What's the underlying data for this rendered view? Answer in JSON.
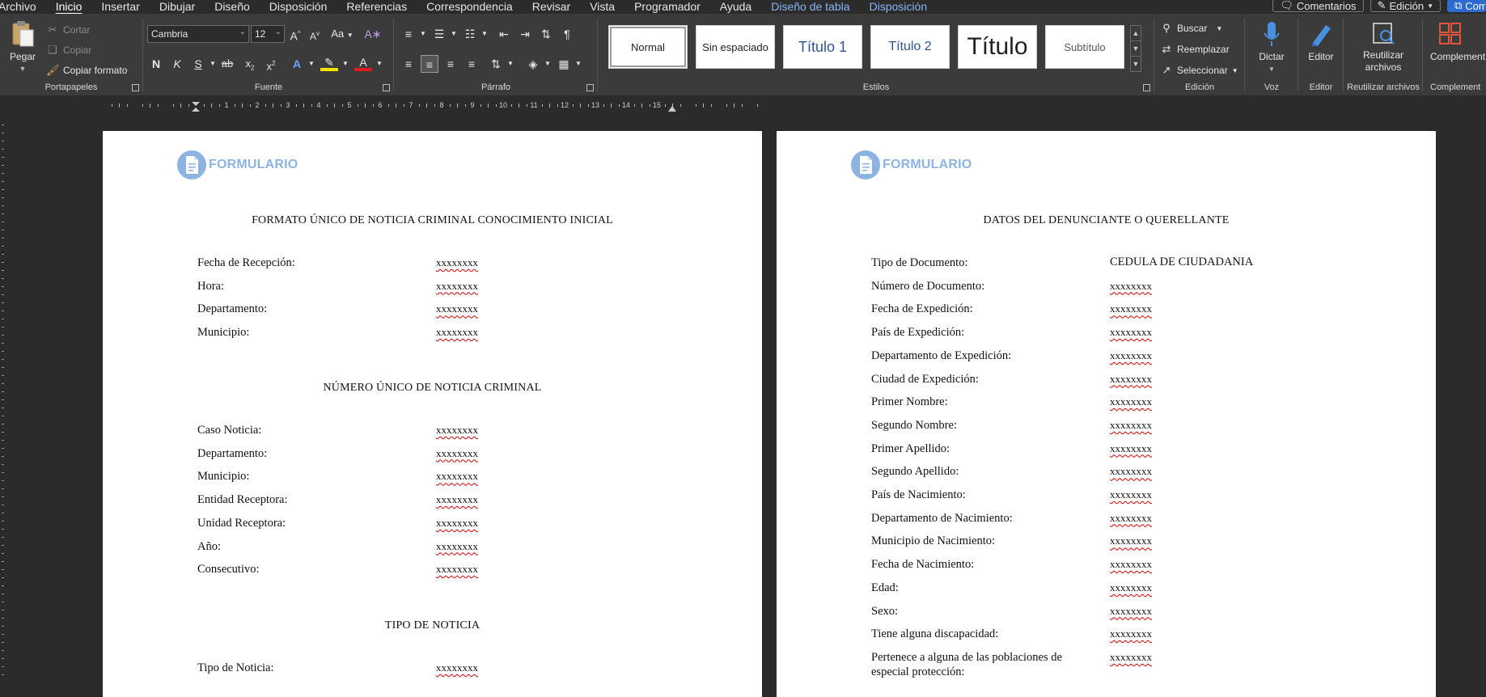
{
  "menu": {
    "tabs": [
      "Archivo",
      "Inicio",
      "Insertar",
      "Dibujar",
      "Diseño",
      "Disposición",
      "Referencias",
      "Correspondencia",
      "Revisar",
      "Vista",
      "Programador",
      "Ayuda"
    ],
    "active_tab": "Inicio",
    "contextual_tabs": [
      "Diseño de tabla",
      "Disposición"
    ],
    "comments_label": "Comentarios",
    "editing_label": "Edición",
    "share_label": "Com"
  },
  "ribbon": {
    "clipboard": {
      "label": "Portapapeles",
      "paste": "Pegar",
      "cut": "Cortar",
      "copy": "Copiar",
      "format_painter": "Copiar formato"
    },
    "font": {
      "label": "Fuente",
      "family": "Cambria",
      "size": "12",
      "change_case": "Aa"
    },
    "paragraph": {
      "label": "Párrafo"
    },
    "styles": {
      "label": "Estilos",
      "items": [
        "Normal",
        "Sin espaciado",
        "Título 1",
        "Título 2",
        "Título",
        "Subtítulo"
      ],
      "selected": "Normal"
    },
    "editing": {
      "label": "Edición",
      "find": "Buscar",
      "replace": "Reemplazar",
      "select": "Seleccionar"
    },
    "voice": {
      "label": "Voz",
      "dictate": "Dictar"
    },
    "editor": {
      "label": "Editor",
      "button": "Editor"
    },
    "reuse": {
      "label": "Reutilizar archivos",
      "button_line1": "Reutilizar",
      "button_line2": "archivos"
    },
    "addins": {
      "label": "Complement",
      "button": "Complement"
    }
  },
  "ruler": {
    "numbers": [
      "1",
      "2",
      "3",
      "4",
      "5",
      "6",
      "7",
      "8",
      "9",
      "10",
      "11",
      "12",
      "13",
      "14",
      "15"
    ]
  },
  "pages": [
    {
      "logo_text": "FORMULARIO",
      "sections": [
        {
          "title": "FORMATO ÚNICO DE NOTICIA CRIMINAL CONOCIMIENTO INICIAL",
          "fields": [
            {
              "label": "Fecha de Recepción:",
              "value": "xxxxxxxx"
            },
            {
              "label": "Hora:",
              "value": "xxxxxxxx"
            },
            {
              "label": "Departamento:",
              "value": "xxxxxxxx"
            },
            {
              "label": "Municipio:",
              "value": "xxxxxxxx"
            }
          ]
        },
        {
          "title": "NÚMERO ÚNICO DE NOTICIA CRIMINAL",
          "fields": [
            {
              "label": "Caso Noticia:",
              "value": "xxxxxxxx"
            },
            {
              "label": "Departamento:",
              "value": "xxxxxxxx"
            },
            {
              "label": "Municipio:",
              "value": "xxxxxxxx"
            },
            {
              "label": "Entidad Receptora:",
              "value": "xxxxxxxx"
            },
            {
              "label": "Unidad Receptora:",
              "value": "xxxxxxxx"
            },
            {
              "label": "Año:",
              "value": "xxxxxxxx"
            },
            {
              "label": "Consecutivo:",
              "value": "xxxxxxxx"
            }
          ]
        },
        {
          "title": "TIPO DE NOTICIA",
          "fields": [
            {
              "label": "Tipo de Noticia:",
              "value": "xxxxxxxx"
            }
          ]
        }
      ]
    },
    {
      "logo_text": "FORMULARIO",
      "sections": [
        {
          "title": "DATOS DEL DENUNCIANTE O QUERELLANTE",
          "fields": [
            {
              "label": "Tipo de Documento:",
              "value": "CEDULA DE CIUDADANIA"
            },
            {
              "label": "Número de Documento:",
              "value": "xxxxxxxx"
            },
            {
              "label": "Fecha de Expedición:",
              "value": "xxxxxxxx"
            },
            {
              "label": "País de Expedición:",
              "value": "xxxxxxxx"
            },
            {
              "label": "Departamento de Expedición:",
              "value": "xxxxxxxx"
            },
            {
              "label": "Ciudad de Expedición:",
              "value": "xxxxxxxx"
            },
            {
              "label": "Primer Nombre:",
              "value": "xxxxxxxx"
            },
            {
              "label": "Segundo Nombre:",
              "value": "xxxxxxxx"
            },
            {
              "label": "Primer Apellido:",
              "value": "xxxxxxxx"
            },
            {
              "label": "Segundo Apellido:",
              "value": "xxxxxxxx"
            },
            {
              "label": "País de Nacimiento:",
              "value": "xxxxxxxx"
            },
            {
              "label": "Departamento de Nacimiento:",
              "value": "xxxxxxxx"
            },
            {
              "label": "Municipio de Nacimiento:",
              "value": "xxxxxxxx"
            },
            {
              "label": "Fecha de Nacimiento:",
              "value": "xxxxxxxx"
            },
            {
              "label": "Edad:",
              "value": "xxxxxxxx"
            },
            {
              "label": "Sexo:",
              "value": "xxxxxxxx"
            },
            {
              "label": "Tiene alguna discapacidad:",
              "value": "xxxxxxxx"
            },
            {
              "label": "Pertenece a alguna de las poblaciones de",
              "label2": "especial protección:",
              "value": "xxxxxxxx"
            }
          ]
        }
      ]
    }
  ]
}
